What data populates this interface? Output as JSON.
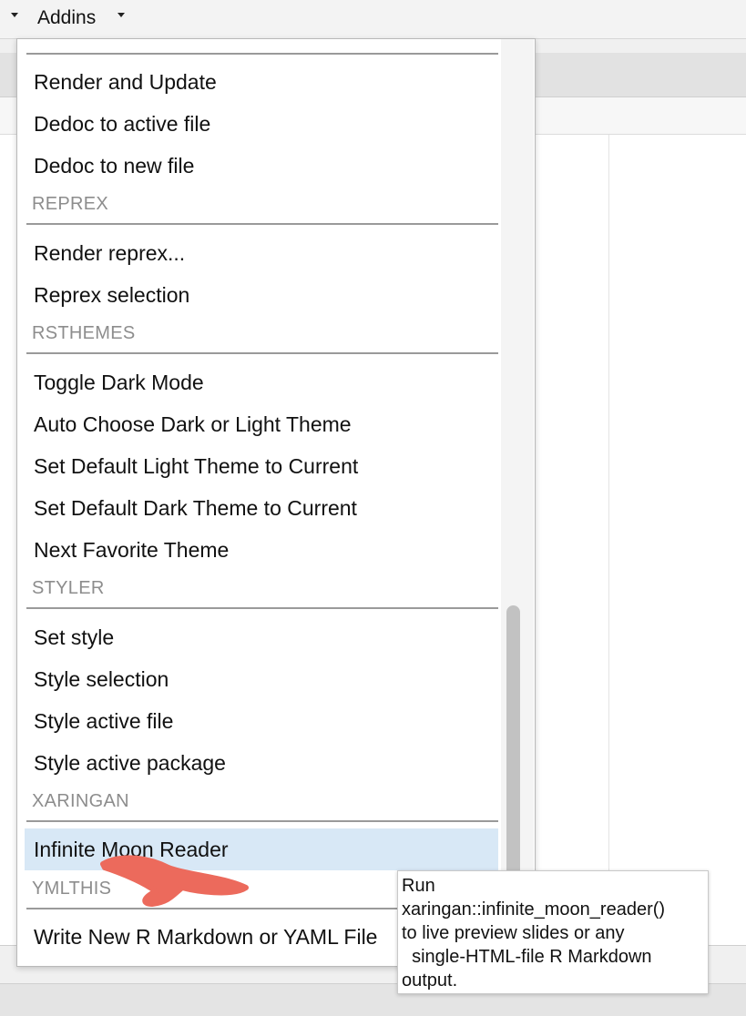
{
  "toolbar": {
    "addins_label": "Addins"
  },
  "menu": {
    "items": [
      {
        "label": "Render and Update"
      },
      {
        "label": "Dedoc to active file"
      },
      {
        "label": "Dedoc to new file"
      },
      {
        "header": "REPREX"
      },
      {
        "label": "Render reprex..."
      },
      {
        "label": "Reprex selection"
      },
      {
        "header": "RSTHEMES"
      },
      {
        "label": "Toggle Dark Mode"
      },
      {
        "label": "Auto Choose Dark or Light Theme"
      },
      {
        "label": "Set Default Light Theme to Current"
      },
      {
        "label": "Set Default Dark Theme to Current"
      },
      {
        "label": "Next Favorite Theme"
      },
      {
        "header": "STYLER"
      },
      {
        "label": "Set style"
      },
      {
        "label": "Style selection"
      },
      {
        "label": "Style active file"
      },
      {
        "label": "Style active package"
      },
      {
        "header": "XARINGAN"
      },
      {
        "label": "Infinite Moon Reader",
        "highlighted": true
      },
      {
        "header": "YMLTHIS"
      },
      {
        "label": "Write New R Markdown or YAML File"
      }
    ]
  },
  "tooltip": {
    "lines": [
      "Run",
      "xaringan::infinite_moon_reader()",
      "to live preview slides or any",
      "  single-HTML-file R Markdown",
      "output."
    ]
  },
  "colors": {
    "highlight": "#d8e8f6",
    "annotation_scribble": "#ec6a5c"
  }
}
